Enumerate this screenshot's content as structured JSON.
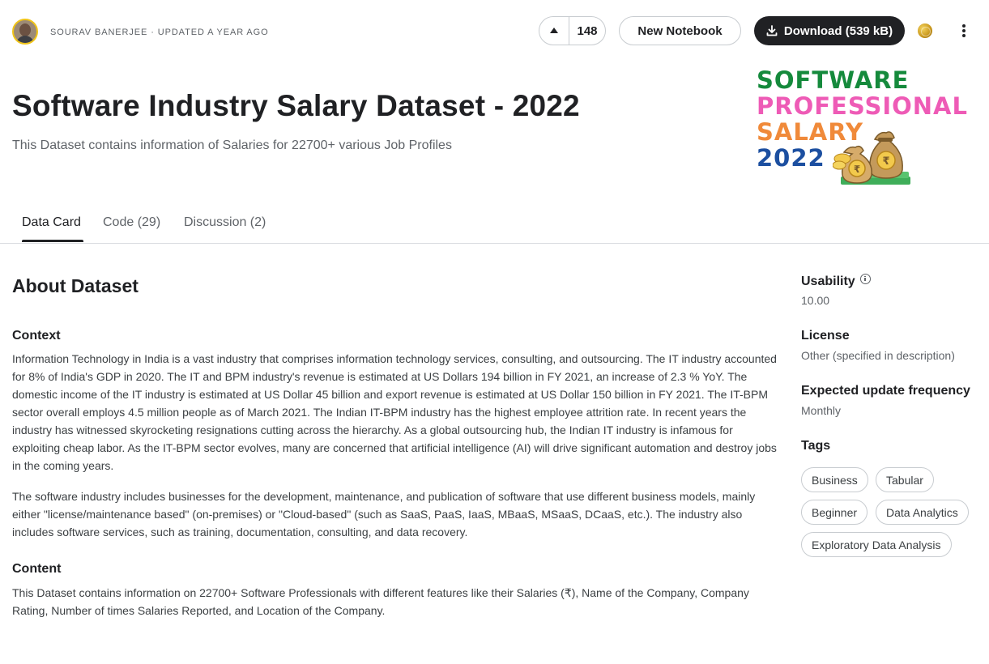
{
  "header": {
    "author_line": "SOURAV BANERJEE · UPDATED A YEAR AGO",
    "upvote_count": "148",
    "new_notebook_label": "New Notebook",
    "download_label": "Download (539 kB)"
  },
  "dataset": {
    "title": "Software Industry Salary Dataset - 2022",
    "subtitle": "This Dataset contains information of Salaries for 22700+ various Job Profiles"
  },
  "cover": {
    "line1": "SOFTWARE",
    "line2": "PROFESSIONAL",
    "line3": "SALARY",
    "line4": "2022",
    "colors": {
      "line1": "#158a3c",
      "line2": "#ee5bb6",
      "line3": "#f08a3a",
      "line4": "#1c4fa0"
    }
  },
  "tabs": [
    {
      "label": "Data Card",
      "active": true
    },
    {
      "label": "Code (29)",
      "active": false
    },
    {
      "label": "Discussion (2)",
      "active": false
    }
  ],
  "about": {
    "heading": "About Dataset",
    "context_heading": "Context",
    "context_p1": "Information Technology in India is a vast industry that comprises information technology services, consulting, and outsourcing. The IT industry accounted for 8% of India's GDP in 2020. The IT and BPM industry's revenue is estimated at US Dollars 194 billion in FY 2021, an increase of 2.3 % YoY. The domestic income of the IT industry is estimated at US Dollar 45 billion and export revenue is estimated at US Dollar 150 billion in FY 2021. The IT-BPM sector overall employs 4.5 million people as of March 2021. The Indian IT-BPM industry has the highest employee attrition rate. In recent years the industry has witnessed skyrocketing resignations cutting across the hierarchy. As a global outsourcing hub, the Indian IT industry is infamous for exploiting cheap labor. As the IT-BPM sector evolves, many are concerned that artificial intelligence (AI) will drive significant automation and destroy jobs in the coming years.",
    "context_p2": "The software industry includes businesses for the development, maintenance, and publication of software that use different business models, mainly either \"license/maintenance based\" (on-premises) or \"Cloud-based\" (such as SaaS, PaaS, IaaS, MBaaS, MSaaS, DCaaS, etc.). The industry also includes software services, such as training, documentation, consulting, and data recovery.",
    "content_heading": "Content",
    "content_p1": "This Dataset contains information on 22700+ Software Professionals with different features like their Salaries (₹), Name of the Company, Company Rating, Number of times Salaries Reported, and Location of the Company."
  },
  "sidebar": {
    "usability_label": "Usability",
    "usability_value": "10.00",
    "license_label": "License",
    "license_value": "Other (specified in description)",
    "frequency_label": "Expected update frequency",
    "frequency_value": "Monthly",
    "tags_label": "Tags",
    "tags": [
      "Business",
      "Tabular",
      "Beginner",
      "Data Analytics",
      "Exploratory Data Analysis"
    ]
  },
  "icons": {
    "upvote": "arrow-up-icon",
    "download": "download-icon",
    "medal": "gold-medal-icon",
    "more": "more-vertical-icon",
    "info": "info-icon"
  }
}
